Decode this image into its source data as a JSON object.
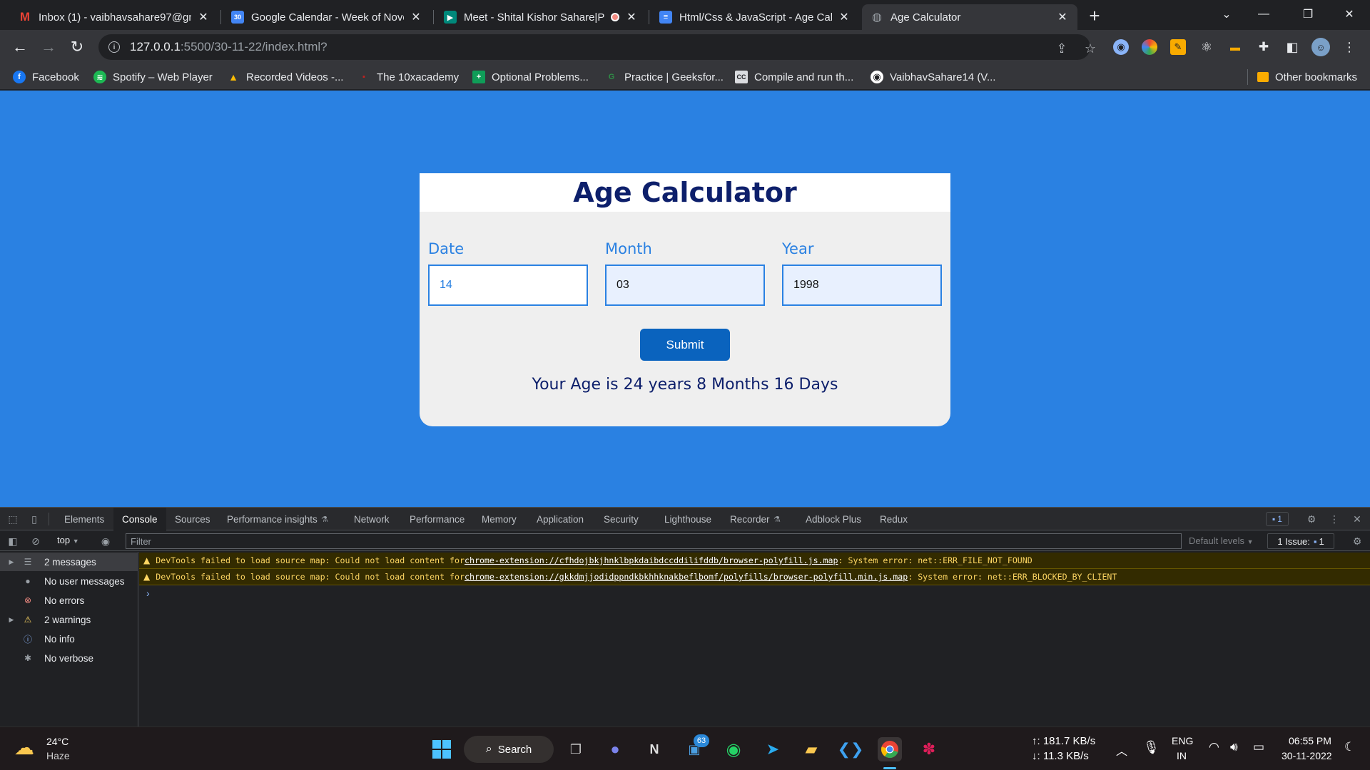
{
  "browser": {
    "tabs": [
      {
        "title": "Inbox (1) - vaibhavsahare97@gm",
        "icon": "gmail-icon",
        "color": "#ea4335"
      },
      {
        "title": "Google Calendar - Week of Nove",
        "icon": "calendar-icon",
        "color": "#4285f4",
        "badge": "30"
      },
      {
        "title": "Meet - Shital Kishor Sahare|P",
        "icon": "meet-icon",
        "color": "#00897b"
      },
      {
        "title": "Html/Css & JavaScript - Age Calc",
        "icon": "docs-icon",
        "color": "#4285f4"
      },
      {
        "title": "Age Calculator",
        "icon": "globe-icon",
        "color": "#9aa0a6"
      }
    ],
    "url_host": "127.0.0.1",
    "url_path": ":5500/30-11-22/index.html?",
    "bookmarks": [
      {
        "label": "Facebook",
        "color": "#1877f2",
        "glyph": "f"
      },
      {
        "label": "Spotify – Web Player",
        "color": "#1db954",
        "glyph": "≋"
      },
      {
        "label": "Recorded Videos -...",
        "color": "#fbbc04",
        "glyph": "▲"
      },
      {
        "label": "The 10xacademy",
        "color": "#c5221f",
        "glyph": "▪"
      },
      {
        "label": "Optional Problems...",
        "color": "#0f9d58",
        "glyph": "+"
      },
      {
        "label": "Practice | Geeksfor...",
        "color": "#2f8d46",
        "glyph": "G"
      },
      {
        "label": "Compile and run th...",
        "color": "#5f6368",
        "glyph": "CC"
      },
      {
        "label": "VaibhavSahare14 (V...",
        "color": "#ffffff",
        "glyph": "◉"
      }
    ],
    "other_bookmarks": "Other bookmarks"
  },
  "app": {
    "title": "Age Calculator",
    "fields": [
      {
        "label": "Date",
        "value": "14"
      },
      {
        "label": "Month",
        "value": "03"
      },
      {
        "label": "Year",
        "value": "1998"
      }
    ],
    "submit_label": "Submit",
    "result": "Your Age is 24 years 8 Months 16 Days"
  },
  "devtools": {
    "tabs": [
      "Elements",
      "Console",
      "Sources",
      "Performance insights",
      "Network",
      "Performance",
      "Memory",
      "Application",
      "Security",
      "Lighthouse",
      "Recorder",
      "Adblock Plus",
      "Redux"
    ],
    "active_tab": "Console",
    "badge_count": "1",
    "context": "top",
    "filter_placeholder": "Filter",
    "default_levels": "Default levels",
    "issues": "1 Issue:",
    "issues_count": "1",
    "sidebar": [
      {
        "label": "2 messages",
        "icon": "list-icon",
        "expandable": true
      },
      {
        "label": "No user messages",
        "icon": "user-icon",
        "expandable": false
      },
      {
        "label": "No errors",
        "icon": "error-icon",
        "expandable": false
      },
      {
        "label": "2 warnings",
        "icon": "warning-icon",
        "expandable": true
      },
      {
        "label": "No info",
        "icon": "info-icon",
        "expandable": false
      },
      {
        "label": "No verbose",
        "icon": "verbose-icon",
        "expandable": false
      }
    ],
    "messages": [
      {
        "prefix": "DevTools failed to load source map: Could not load content for ",
        "link": "chrome-extension://cfhdojbkjhnklbpkdaibdccddilifddb/browser-polyfill.js.map",
        "suffix": ": System error: net::ERR_FILE_NOT_FOUND"
      },
      {
        "prefix": "DevTools failed to load source map: Could not load content for ",
        "link": "chrome-extension://gkkdmjjodidppndkbkhhknakbeflbomf/polyfills/browser-polyfill.min.js.map",
        "suffix": ": System error: net::ERR_BLOCKED_BY_CLIENT"
      }
    ],
    "prompt": "›"
  },
  "taskbar": {
    "weather_temp": "24°C",
    "weather_desc": "Haze",
    "search_label": "Search",
    "teams_badge": "63",
    "net_up": "↑: 181.7 KB/s",
    "net_down": "↓: 11.3 KB/s",
    "lang_top": "ENG",
    "lang_bottom": "IN",
    "time": "06:55 PM",
    "date": "30-11-2022"
  },
  "colors": {
    "page_bg": "#2a81e2",
    "title": "#0d1f6b",
    "button": "#0a63be"
  }
}
